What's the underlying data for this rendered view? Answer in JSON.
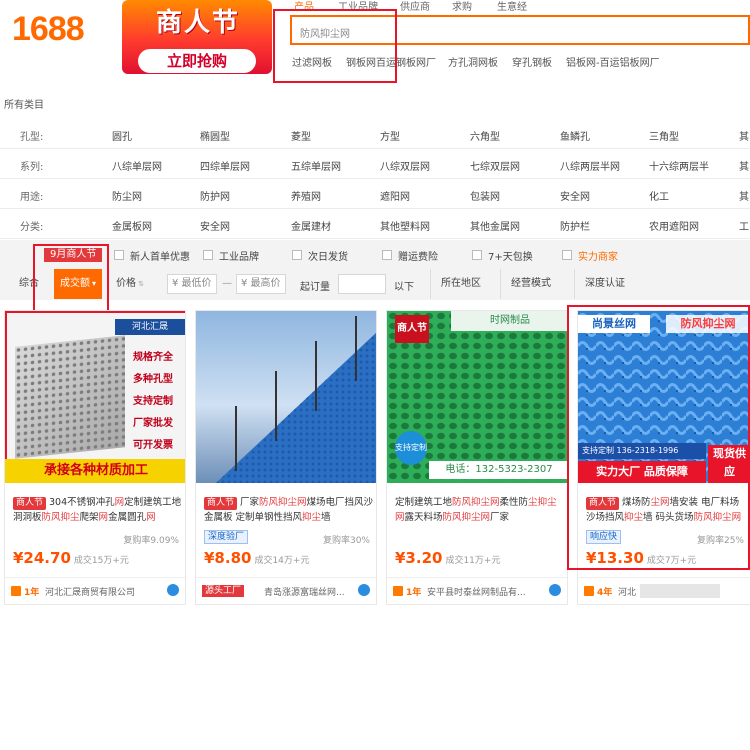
{
  "header": {
    "logo": "1688",
    "promo_title": "商人节",
    "promo_button": "立即抢购",
    "nav_tabs": [
      "产品",
      "工业品牌",
      "供应商",
      "求购",
      "生意经"
    ],
    "search_value": "防风抑尘网",
    "hot_words": [
      "过滤网板",
      "钢板网百运钢板网厂",
      "方孔洞网板",
      "穿孔钢板",
      "铝板网-百运铝板网厂"
    ]
  },
  "categories": {
    "all_label": "所有类目",
    "rows": [
      {
        "label": "孔型:",
        "values": [
          "圆孔",
          "椭圆型",
          "菱型",
          "方型",
          "六角型",
          "鱼鳞孔",
          "三角型",
          "其"
        ]
      },
      {
        "label": "系列:",
        "values": [
          "八综单层网",
          "四综单层网",
          "五综单层网",
          "八综双层网",
          "七综双层网",
          "八综两层半网",
          "十六综两层半",
          "其"
        ]
      },
      {
        "label": "用途:",
        "values": [
          "防尘网",
          "防护网",
          "养殖网",
          "遮阳网",
          "包装网",
          "安全网",
          "化工",
          "其"
        ]
      },
      {
        "label": "分类:",
        "values": [
          "金属板网",
          "安全网",
          "金属建材",
          "其他塑料网",
          "其他金属网",
          "防护栏",
          "农用遮阳网",
          "工"
        ]
      }
    ]
  },
  "filters": {
    "tag": "9月商人节",
    "options": [
      "新人首单优惠",
      "工业品牌",
      "次日发货",
      "赠运费险",
      "7+天包换",
      "实力商家"
    ],
    "sort_label": "综合",
    "sort_active": "成交额",
    "price_label": "价格",
    "min_price_placeholder": "¥ 最低价",
    "dash": "—",
    "max_price_placeholder": "¥ 最高价",
    "moq_label": "起订量",
    "below_label": "以下",
    "region_label": "所在地区",
    "mode_label": "经营模式",
    "cert_label": "深度认证"
  },
  "products": [
    {
      "tag": "商人节",
      "title_parts": [
        "304不锈钢冲孔",
        "网",
        "定制建筑工地",
        "洞洞板",
        "防风抑尘",
        "爬架",
        "网",
        "金属圆孔",
        "网"
      ],
      "badge": "",
      "rate": "复购率9.09%",
      "price": "¥24.70",
      "deal": "成交15万+元",
      "years": "1年",
      "shop": "河北汇晟商贸有限公司",
      "image": {
        "brand": "河北汇晟",
        "lines": [
          "规格齐全",
          "多种孔型",
          "支持定制",
          "厂家批发",
          "可开发票"
        ],
        "banner": "承接各种材质加工"
      }
    },
    {
      "tag": "商人节",
      "title_parts": [
        "厂家",
        "防风抑尘网",
        "煤场电厂挡风沙金属板 定制单钢性挡风",
        "抑尘",
        "墙"
      ],
      "badge": "深度验厂",
      "rate": "复购率30%",
      "price": "¥8.80",
      "deal": "成交14万+元",
      "years": "源头工厂",
      "shop": "青岛涨源富瑞丝网...",
      "image": {}
    },
    {
      "tag": "",
      "title_parts": [
        "定制建筑工地",
        "防风抑尘网",
        "柔性防",
        "尘",
        "抑",
        "尘网",
        "露天料场",
        "防风抑尘网",
        "厂家"
      ],
      "badge": "",
      "rate": "",
      "price": "¥3.20",
      "deal": "成交11万+元",
      "years": "1年",
      "shop": "安平县时泰丝网制品有...",
      "image": {
        "label": "支持定制",
        "phone": "电话：132-5323-2307",
        "corner": "商人节",
        "top": "时网制品"
      }
    },
    {
      "tag": "商人节",
      "title_parts": [
        "煤场防",
        "尘网",
        "墙安装 电厂料场沙场挡风",
        "抑尘",
        "墙 码头货场",
        "防风抑尘网"
      ],
      "badge": "响应快",
      "rate": "复购率25%",
      "price": "¥13.30",
      "deal": "成交7万+元",
      "years": "4年",
      "shop": "河北",
      "image": {
        "brand": "尚景丝网",
        "product": "防风抑尘网",
        "phone": "支持定制 136-2318-1996",
        "banner": "实力大厂 品质保障",
        "corner": "现货供应"
      }
    }
  ],
  "colors": {
    "brand": "#ff6a00",
    "highlight": "#e4393c",
    "frame": "#e8142a"
  }
}
